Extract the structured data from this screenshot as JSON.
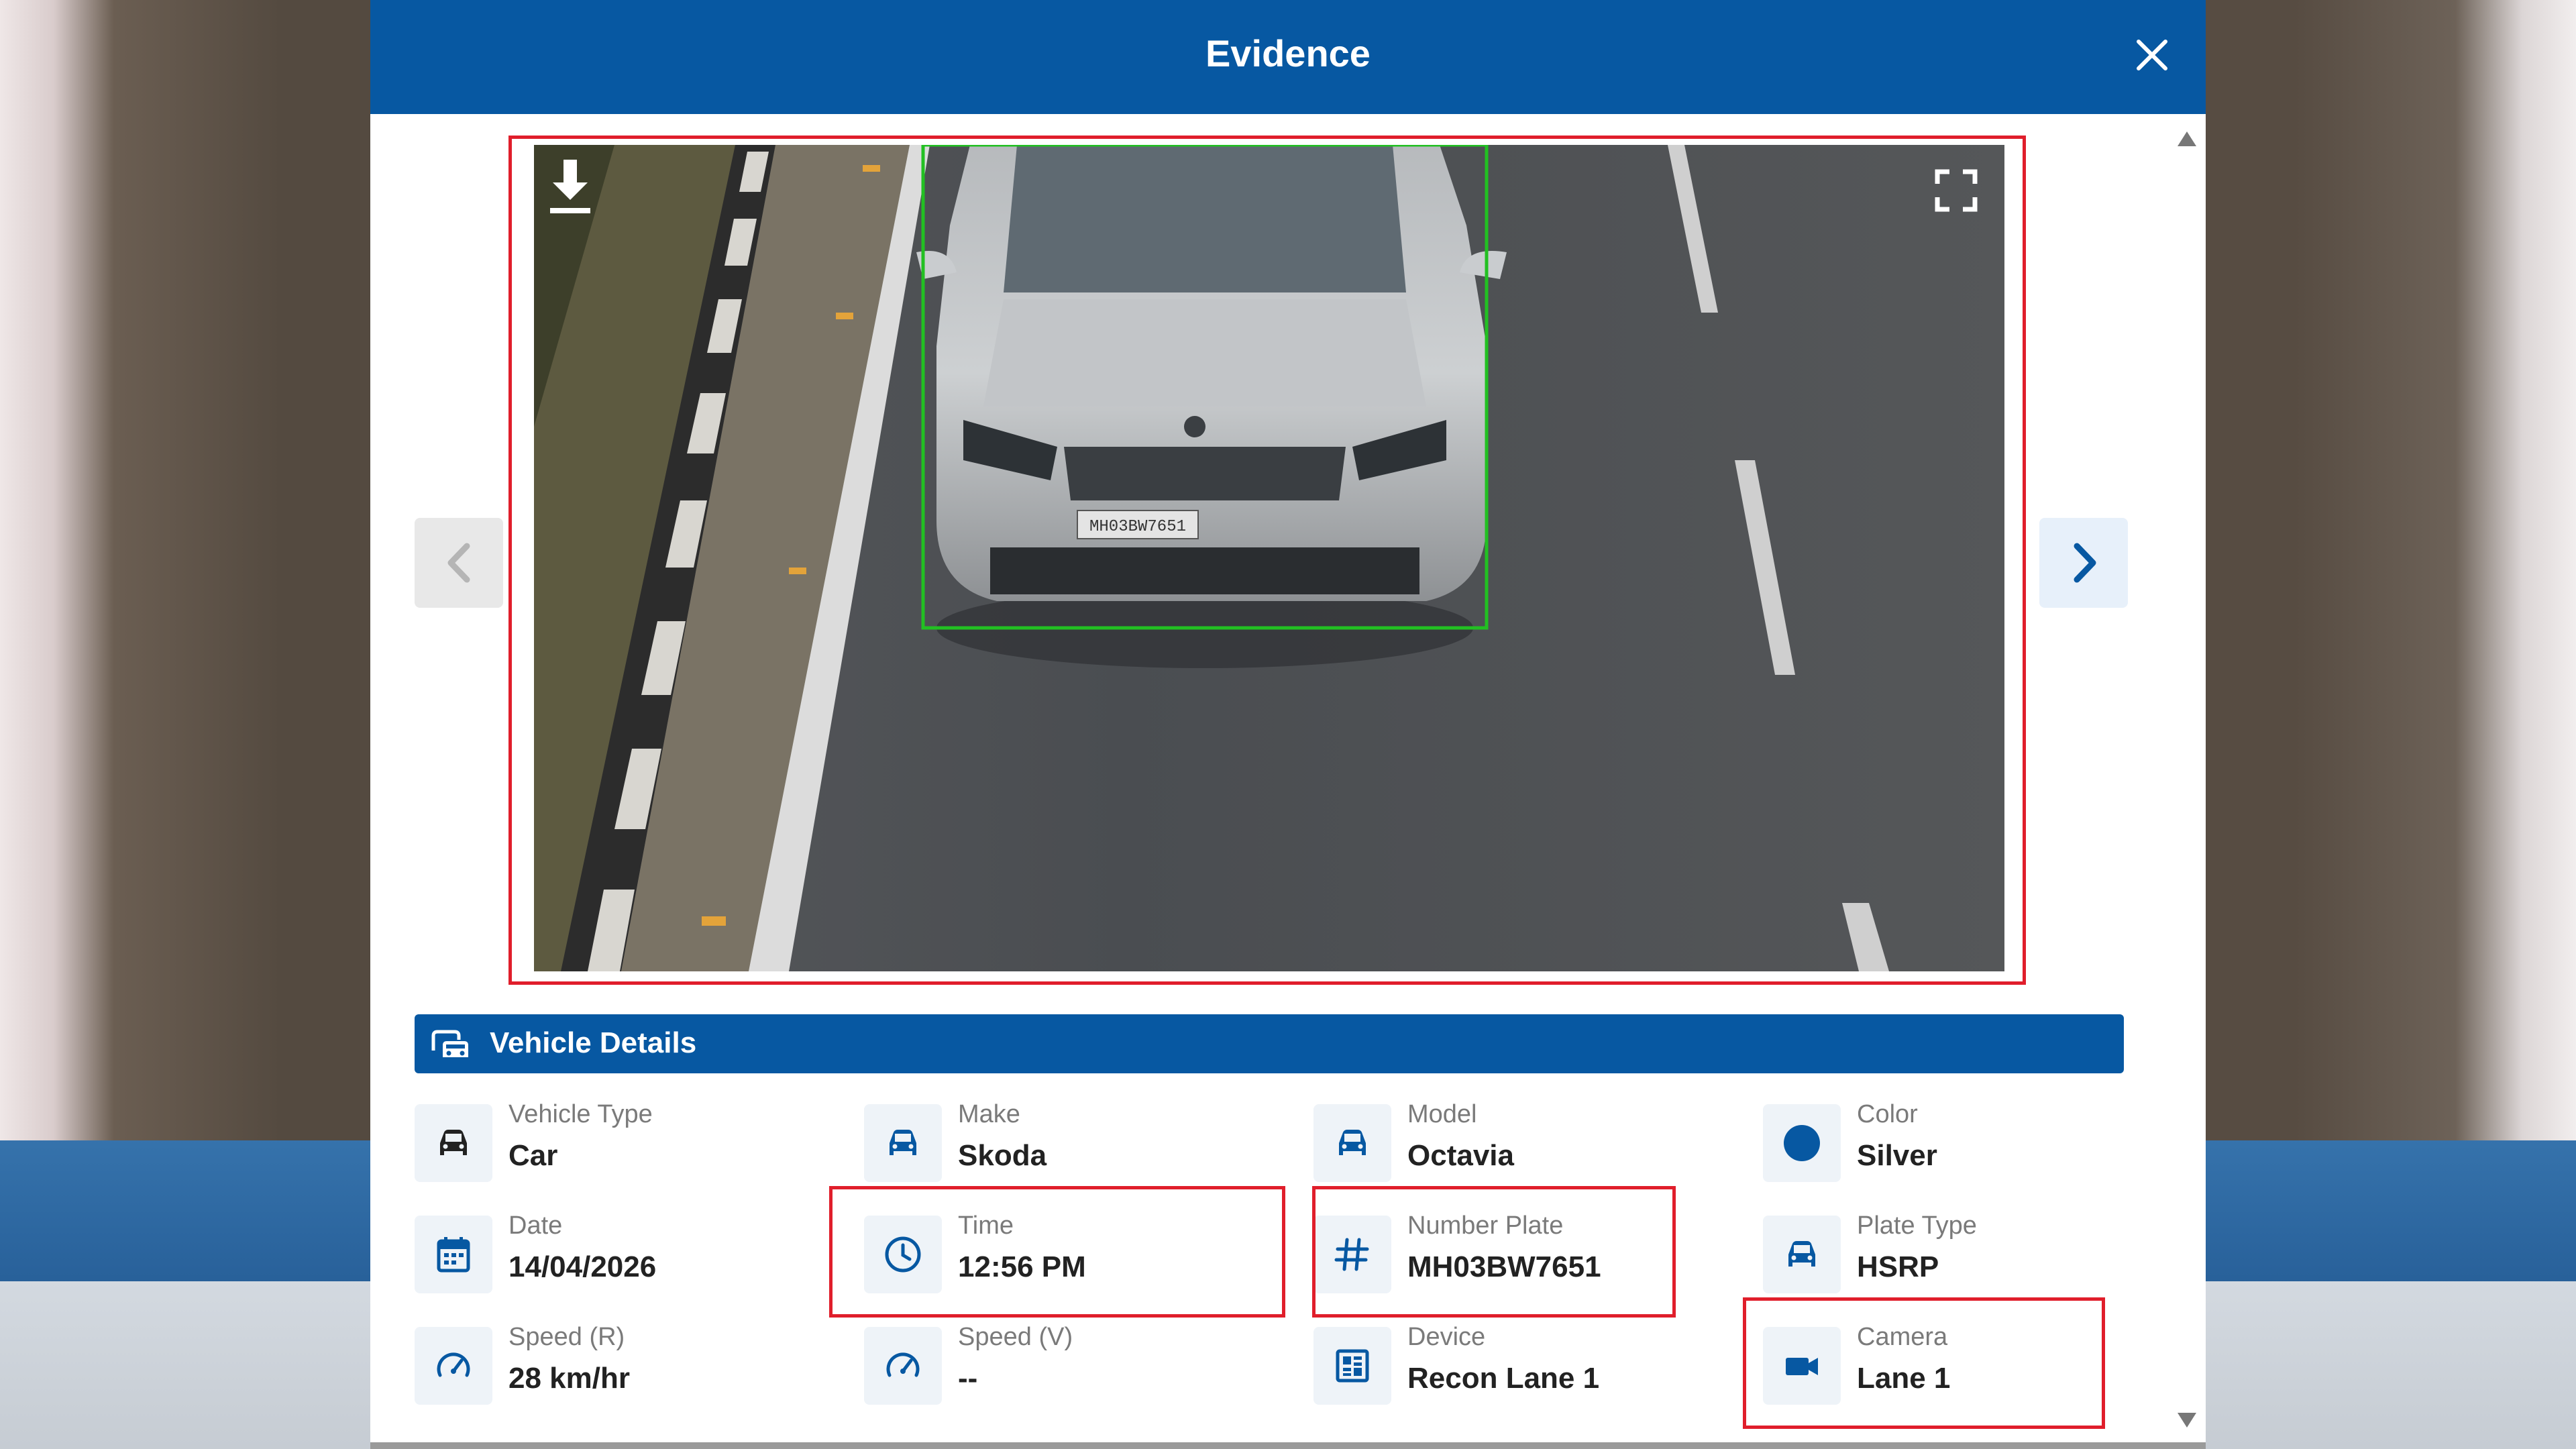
{
  "modal": {
    "title": "Evidence"
  },
  "image": {
    "plate_text": "MH03BW7651"
  },
  "section": {
    "title": "Vehicle Details"
  },
  "details": [
    {
      "label": "Vehicle Type",
      "value": "Car",
      "icon": "car-icon"
    },
    {
      "label": "Make",
      "value": "Skoda",
      "icon": "car-front-icon"
    },
    {
      "label": "Model",
      "value": "Octavia",
      "icon": "car-front-icon"
    },
    {
      "label": "Color",
      "value": "Silver",
      "icon": "color-dot-icon"
    },
    {
      "label": "Date",
      "value": "14/04/2026",
      "icon": "calendar-icon"
    },
    {
      "label": "Time",
      "value": "12:56 PM",
      "icon": "clock-icon"
    },
    {
      "label": "Number Plate",
      "value": "MH03BW7651",
      "icon": "hash-icon"
    },
    {
      "label": "Plate Type",
      "value": "HSRP",
      "icon": "car-front-icon"
    },
    {
      "label": "Speed (R)",
      "value": "28 km/hr",
      "icon": "speedometer-icon"
    },
    {
      "label": "Speed (V)",
      "value": "--",
      "icon": "speedometer-icon"
    },
    {
      "label": "Device",
      "value": "Recon Lane 1",
      "icon": "device-icon"
    },
    {
      "label": "Camera",
      "value": "Lane 1",
      "icon": "video-camera-icon"
    }
  ],
  "colors": {
    "header": "#0758a2",
    "highlight": "#e01e2b",
    "detection_box": "#22c022",
    "icon": "#0758a2"
  }
}
